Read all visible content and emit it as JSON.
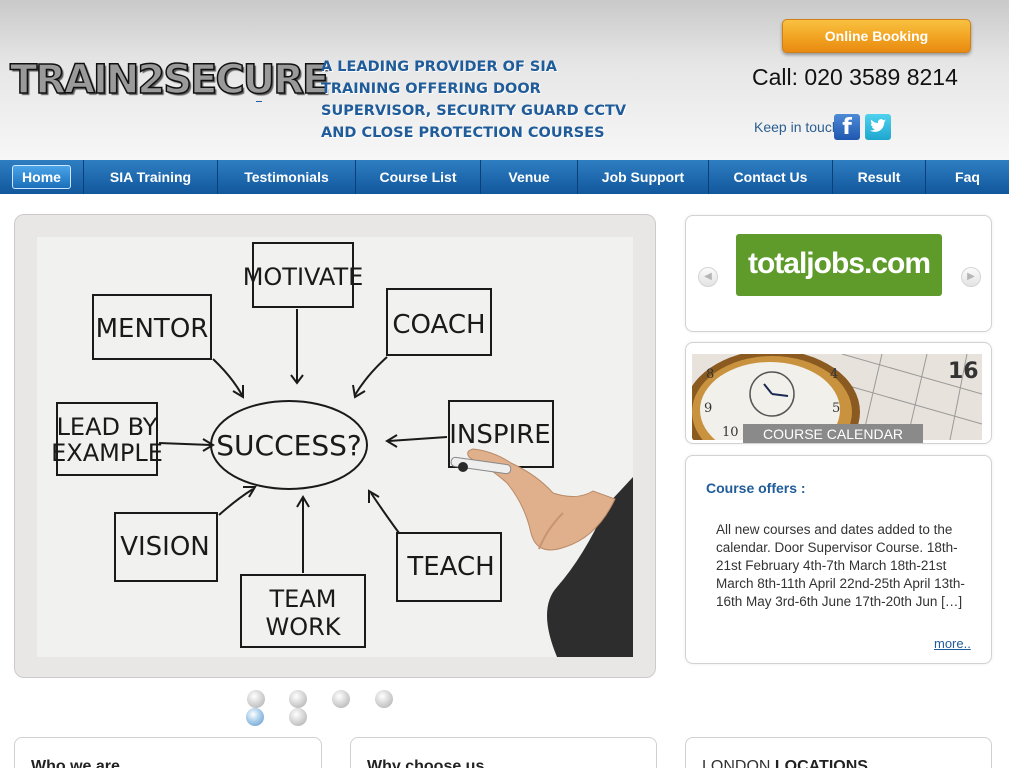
{
  "header": {
    "logo_text": "TRAIN2SECURE",
    "tagline": "A LEADING PROVIDER OF SIA TRAINING OFFERING DOOR SUPERVISOR, SECURITY GUARD CCTV AND CLOSE PROTECTION COURSES",
    "booking_label": "Online Booking",
    "phone": "Call: 020 3589 8214",
    "keep_in_touch": "Keep in touch",
    "facebook_icon": "facebook-icon",
    "twitter_icon": "twitter-icon"
  },
  "nav": {
    "items": [
      {
        "label": "Home",
        "active": true
      },
      {
        "label": "SIA Training"
      },
      {
        "label": "Testimonials"
      },
      {
        "label": "Course List"
      },
      {
        "label": "Venue"
      },
      {
        "label": "Job Support"
      },
      {
        "label": "Contact Us"
      },
      {
        "label": "Result"
      },
      {
        "label": "Faq"
      }
    ]
  },
  "slider": {
    "words": {
      "motivate": "MOTIVATE",
      "mentor": "MENTOR",
      "coach": "COACH",
      "lead1": "LEAD BY",
      "lead2": "EXAMPLE",
      "success": "SUCCESS?",
      "inspire": "INSPIRE",
      "vision": "VISION",
      "teach": "TEACH",
      "team": "TEAM",
      "work": "WORK"
    },
    "dots_count": 6,
    "active_dot": 5
  },
  "ad": {
    "logo_text": "totaljobs.com",
    "prev_icon": "arrow-left-icon",
    "next_icon": "arrow-right-icon"
  },
  "calendar": {
    "label": "COURSE CALENDAR",
    "date_number": "16"
  },
  "offers": {
    "title": "Course offers :",
    "body": "All new courses and dates added to the calendar.   Door Supervisor Course. 18th-21st February 4th-7th March 18th-21st March 8th-11th April 22nd-25th April 13th-16th May 3rd-6th June 17th-20th Jun   […]",
    "more": "more.."
  },
  "bottom": {
    "who": "Who we are",
    "why": "Why choose us",
    "loc_light": "LONDON ",
    "loc_bold": "LOCATIONS"
  },
  "colors": {
    "brand_blue": "#1f5c99",
    "nav_blue": "#11579c",
    "booking_orange": "#f2a321",
    "totaljobs_green": "#5e9b2b"
  }
}
